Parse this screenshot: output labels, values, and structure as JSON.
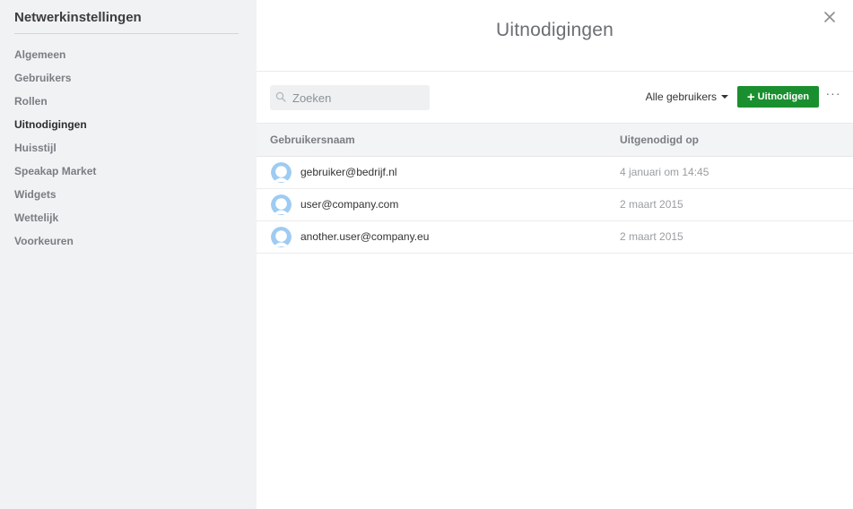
{
  "sidebar": {
    "title": "Netwerkinstellingen",
    "items": [
      {
        "label": "Algemeen",
        "active": false
      },
      {
        "label": "Gebruikers",
        "active": false
      },
      {
        "label": "Rollen",
        "active": false
      },
      {
        "label": "Uitnodigingen",
        "active": true
      },
      {
        "label": "Huisstijl",
        "active": false
      },
      {
        "label": "Speakap Market",
        "active": false
      },
      {
        "label": "Widgets",
        "active": false
      },
      {
        "label": "Wettelijk",
        "active": false
      },
      {
        "label": "Voorkeuren",
        "active": false
      }
    ]
  },
  "main": {
    "title": "Uitnodigingen",
    "close_icon": "close-icon"
  },
  "toolbar": {
    "search_placeholder": "Zoeken",
    "search_value": "",
    "filter_label": "Alle gebruikers",
    "invite_plus": "+",
    "invite_label": "Uitnodigen",
    "more_label": "···"
  },
  "table": {
    "columns": {
      "name": "Gebruikersnaam",
      "invited_on": "Uitgenodigd op"
    },
    "rows": [
      {
        "name": "gebruiker@bedrijf.nl",
        "invited_on": "4 januari om 14:45"
      },
      {
        "name": "user@company.com",
        "invited_on": "2 maart 2015"
      },
      {
        "name": "another.user@company.eu",
        "invited_on": "2 maart 2015"
      }
    ]
  },
  "colors": {
    "sidebar_bg": "#f1f2f4",
    "accent_green": "#1a8f2f",
    "avatar_blue": "#9ecbf2"
  }
}
